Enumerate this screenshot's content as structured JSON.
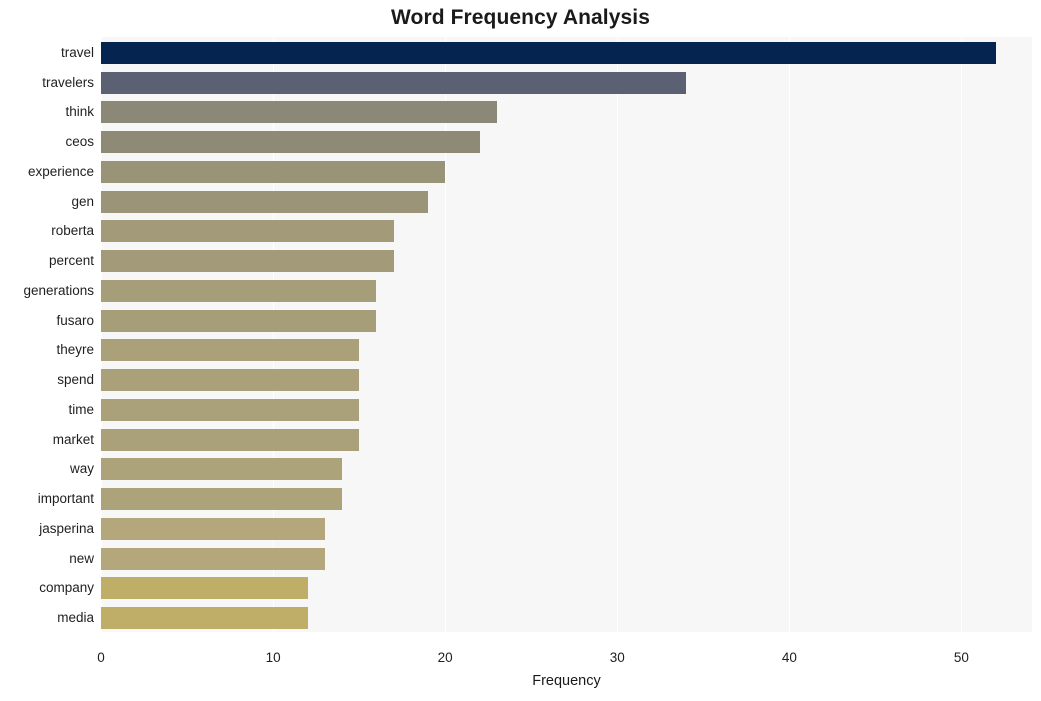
{
  "chart_data": {
    "type": "bar",
    "orientation": "horizontal",
    "title": "Word Frequency Analysis",
    "xlabel": "Frequency",
    "ylabel": "",
    "categories": [
      "travel",
      "travelers",
      "think",
      "ceos",
      "experience",
      "gen",
      "roberta",
      "percent",
      "generations",
      "fusaro",
      "theyre",
      "spend",
      "time",
      "market",
      "way",
      "important",
      "jasperina",
      "new",
      "company",
      "media"
    ],
    "values": [
      52,
      34,
      23,
      22,
      20,
      19,
      17,
      17,
      16,
      16,
      15,
      15,
      15,
      15,
      14,
      14,
      13,
      13,
      12,
      12
    ],
    "xlim": [
      0,
      54.1
    ],
    "xticks": [
      0,
      10,
      20,
      30,
      40,
      50
    ],
    "xtick_labels": [
      "0",
      "10",
      "20",
      "30",
      "40",
      "50"
    ],
    "grid": "vertical",
    "legend": null,
    "bar_colors": [
      "#05244f",
      "#5b6072",
      "#8b8878",
      "#8e8a76",
      "#999377",
      "#9b9478",
      "#a39a79",
      "#a39a79",
      "#a69d79",
      "#a69d79",
      "#aaa07a",
      "#aaa07a",
      "#aaa07a",
      "#aaa07a",
      "#ada37a",
      "#ada37a",
      "#b3a77b",
      "#b3a77b",
      "#bfae68",
      "#bfae68"
    ],
    "plot_background": "#f7f7f7",
    "gridline_color": "#ffffff",
    "figure_background": "#ffffff"
  }
}
